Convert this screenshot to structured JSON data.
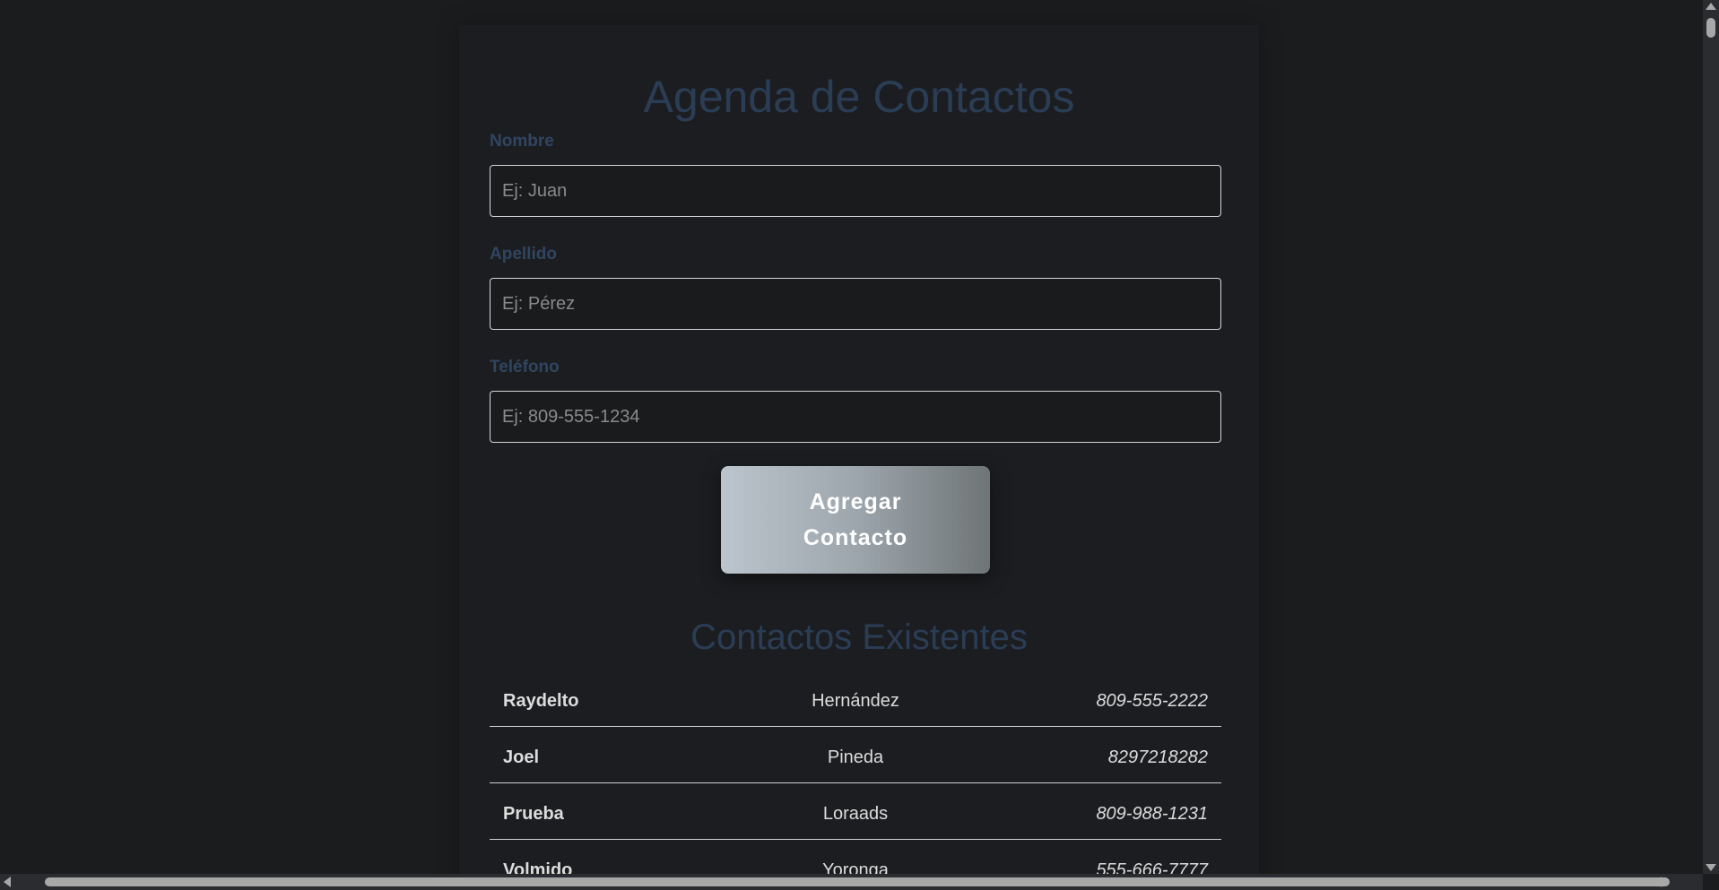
{
  "page": {
    "title": "Agenda de Contactos"
  },
  "form": {
    "nombre": {
      "label": "Nombre",
      "placeholder": "Ej: Juan",
      "value": ""
    },
    "apellido": {
      "label": "Apellido",
      "placeholder": "Ej: Pérez",
      "value": ""
    },
    "telefono": {
      "label": "Teléfono",
      "placeholder": "Ej: 809-555-1234",
      "value": ""
    },
    "submit_label": "Agregar Contacto"
  },
  "contacts": {
    "title": "Contactos Existentes",
    "items": [
      {
        "nombre": "Raydelto",
        "apellido": "Hernández",
        "telefono": "809-555-2222"
      },
      {
        "nombre": "Joel",
        "apellido": "Pineda",
        "telefono": "8297218282"
      },
      {
        "nombre": "Prueba",
        "apellido": "Loraads",
        "telefono": "809-988-1231"
      },
      {
        "nombre": "Volmido",
        "apellido": "Yoronga",
        "telefono": "555-666-7777"
      }
    ]
  },
  "colors": {
    "background": "#1b1c1e",
    "heading": "#2a3d55",
    "label": "#2f4561",
    "button_gradient_start": "#bcc4cd",
    "button_gradient_end": "#6e7576"
  }
}
